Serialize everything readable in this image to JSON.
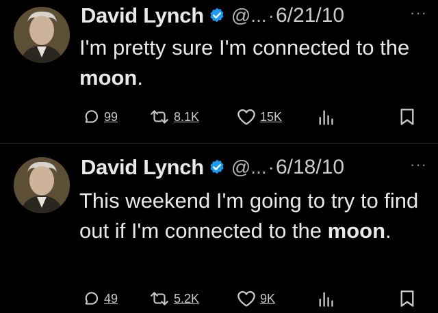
{
  "tweets": [
    {
      "author": "David Lynch",
      "handle": "@...",
      "separator": "·",
      "date": "6/21/10",
      "text_before": "I'm pretty sure I'm connected to the ",
      "text_bold": "moon",
      "text_after": ".",
      "replies": "99",
      "retweets": "8.1K",
      "likes": "15K",
      "more": "···"
    },
    {
      "author": "David Lynch",
      "handle": "@...",
      "separator": "·",
      "date": "6/18/10",
      "text_before": "This weekend I'm going to try to find out if I'm connected to the ",
      "text_bold": "moon",
      "text_after": ".",
      "replies": "49",
      "retweets": "5.2K",
      "likes": "9K",
      "more": "···"
    }
  ],
  "colors": {
    "background": "#000000",
    "text": "#e7e9ea",
    "secondary": "#b0b6ba",
    "verified": "#1d9bf0"
  },
  "icons": [
    "reply-icon",
    "retweet-icon",
    "like-icon",
    "views-icon",
    "bookmark-icon",
    "verified-icon",
    "more-icon"
  ]
}
